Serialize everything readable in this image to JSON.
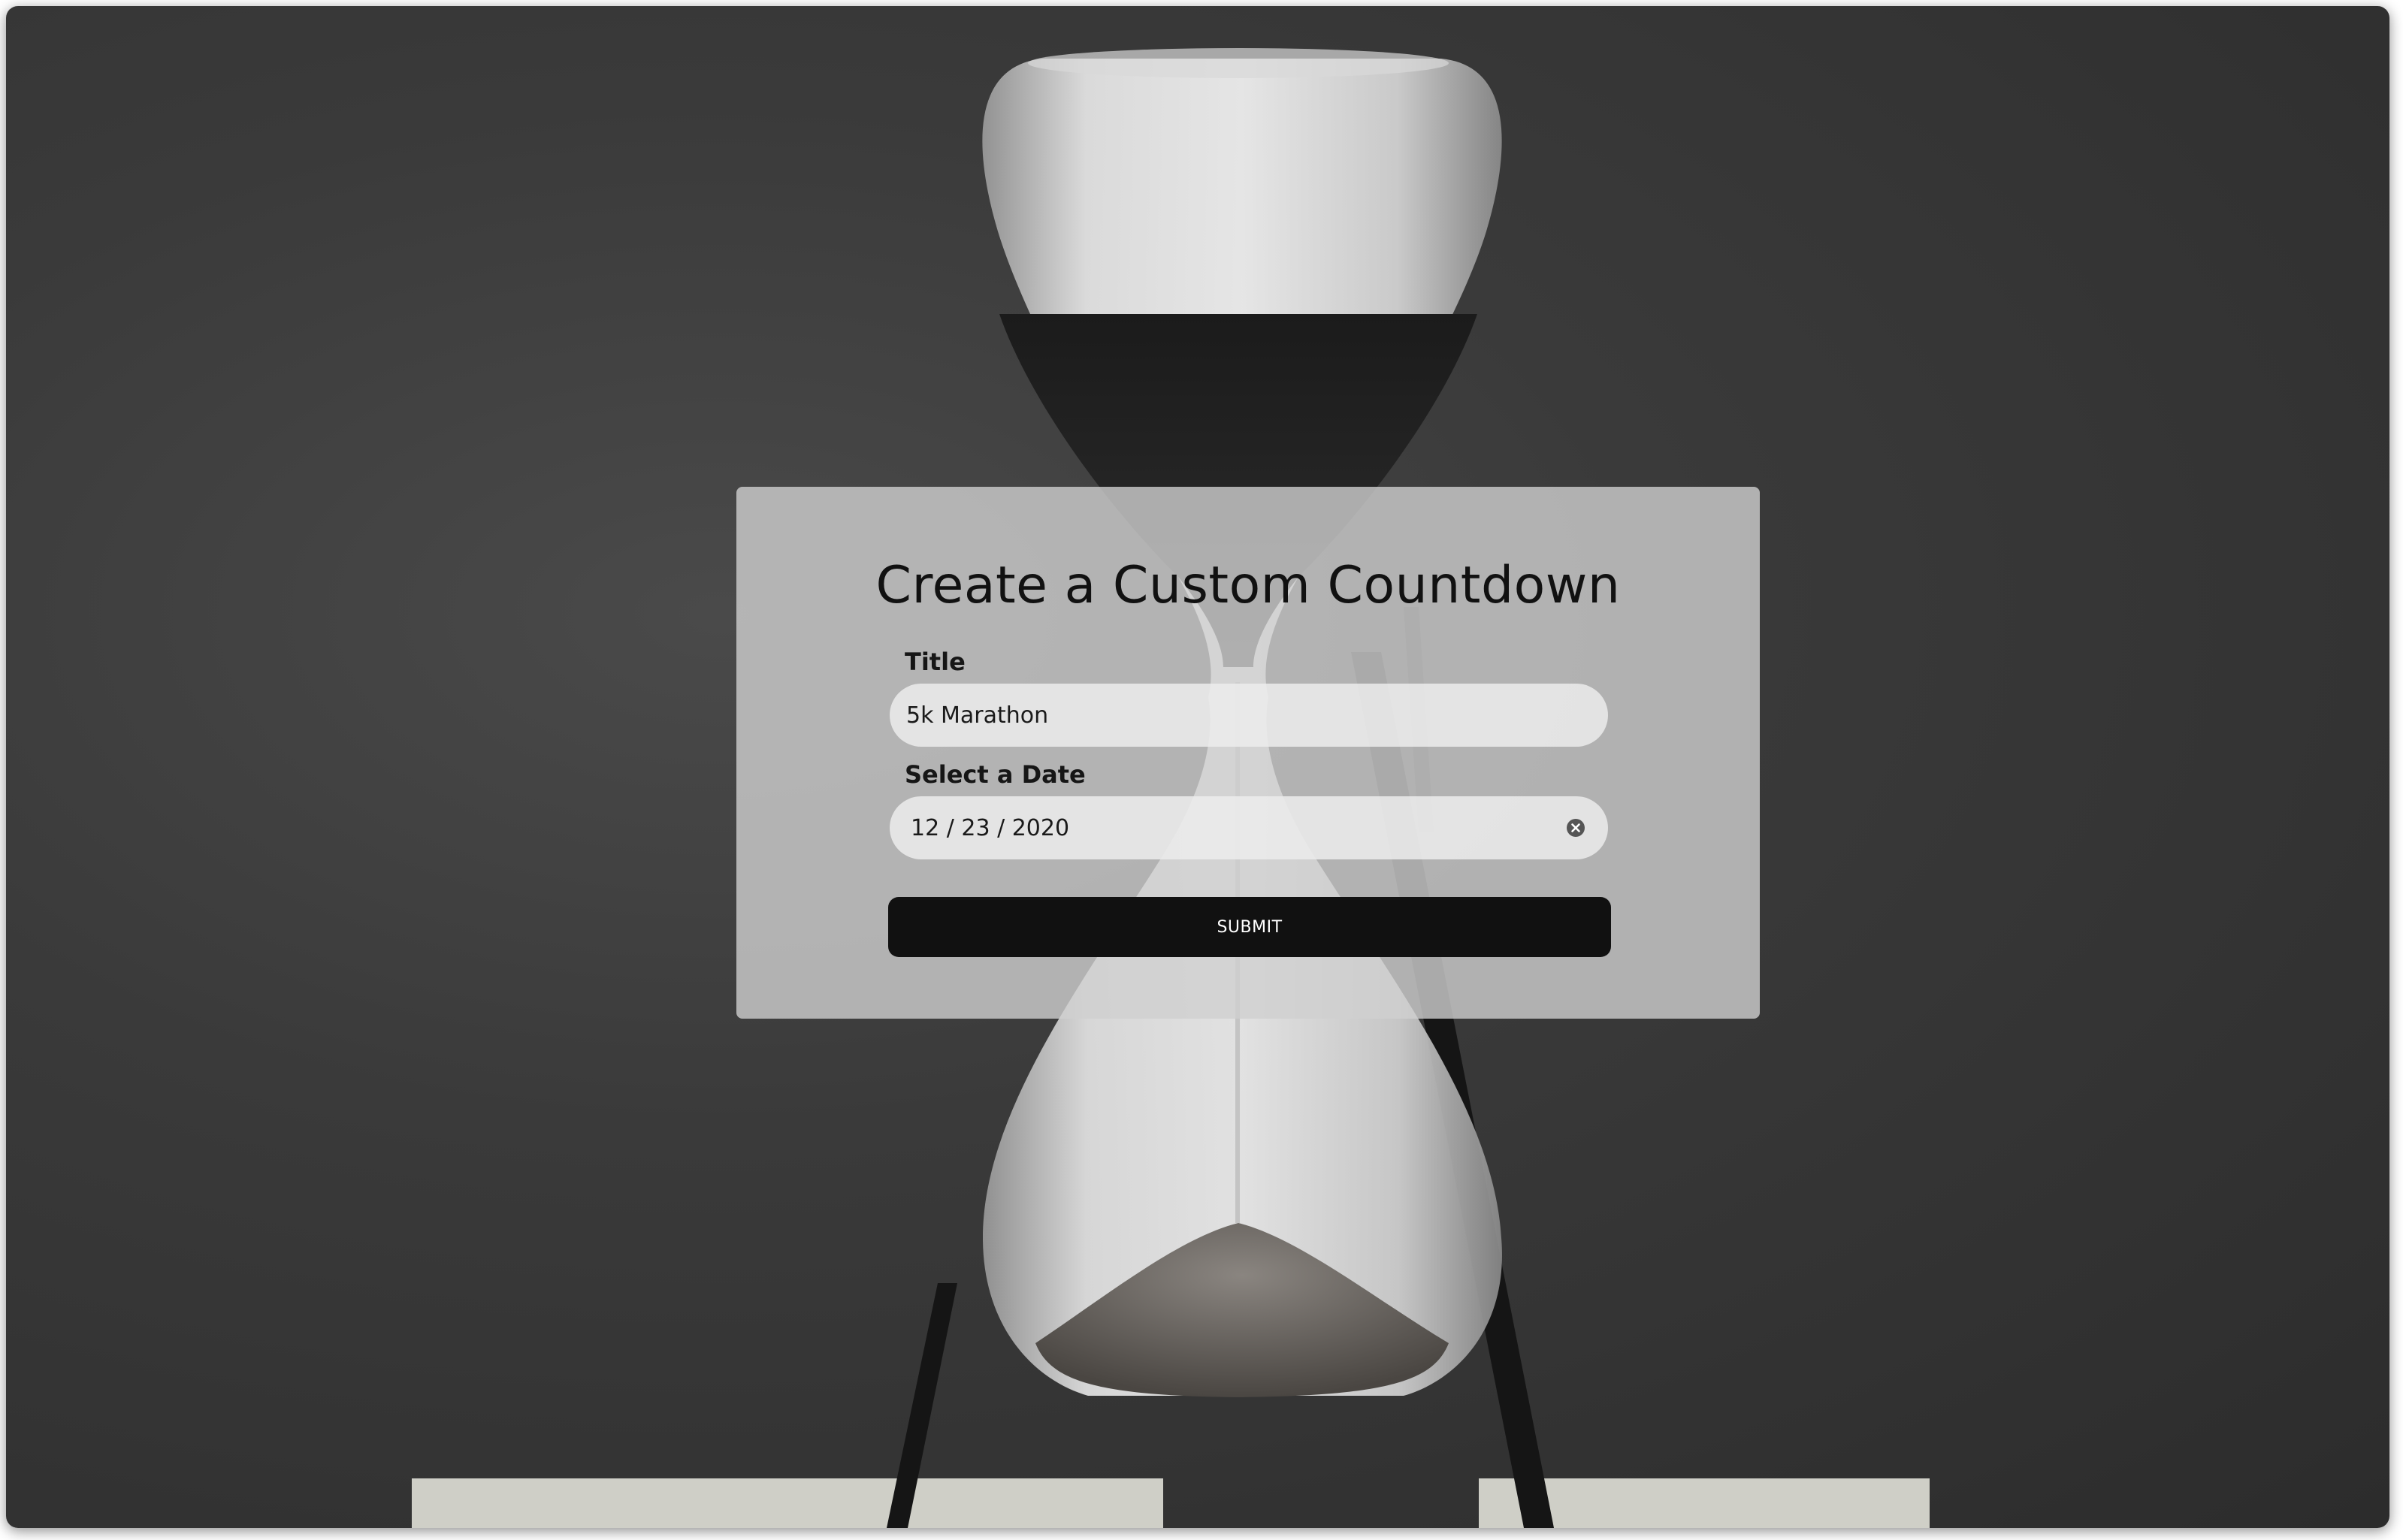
{
  "form": {
    "heading": "Create a Custom Countdown",
    "title_label": "Title",
    "title_value": "5k Marathon",
    "date_label": "Select a Date",
    "date_value": "12 / 23 / 2020",
    "submit_label": "SUBMIT"
  },
  "colors": {
    "card_background": "#d0d0d0",
    "submit_background": "#111111",
    "submit_text": "#ffffff",
    "page_background": "#3a3a3a"
  },
  "icons": {
    "date_clear": "clear-circle-x-icon"
  }
}
